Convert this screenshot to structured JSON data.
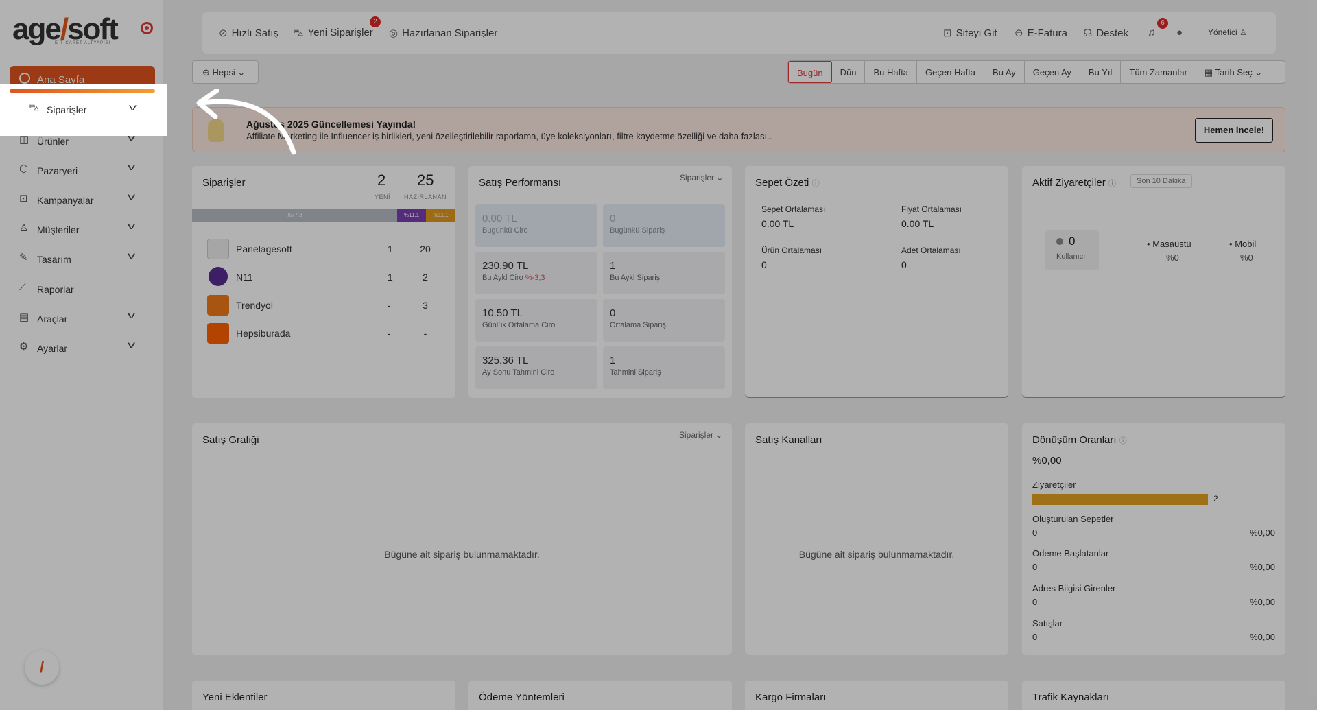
{
  "logo": {
    "brand_pre": "age",
    "brand_post": "soft",
    "tagline": "E-TİCARET ALTYAPISI"
  },
  "sidebar": {
    "home": "Ana Sayfa",
    "items": [
      {
        "label": "Siparişler",
        "icon": "cart-icon",
        "expandable": true
      },
      {
        "label": "Ürünler",
        "icon": "box-icon",
        "expandable": true
      },
      {
        "label": "Pazaryeri",
        "icon": "cube-icon",
        "expandable": true
      },
      {
        "label": "Kampanyalar",
        "icon": "gift-icon",
        "expandable": true
      },
      {
        "label": "Müşteriler",
        "icon": "user-icon",
        "expandable": true
      },
      {
        "label": "Tasarım",
        "icon": "pencil-icon",
        "expandable": true
      },
      {
        "label": "Raporlar",
        "icon": "chart-icon",
        "expandable": false
      },
      {
        "label": "Araçlar",
        "icon": "tools-icon",
        "expandable": true
      },
      {
        "label": "Ayarlar",
        "icon": "gear-icon",
        "expandable": true
      }
    ]
  },
  "topbar": {
    "quick_sale": "Hızlı Satış",
    "new_orders": "Yeni Siparişler",
    "new_orders_badge": "2",
    "preparing": "Hazırlanan Siparişler",
    "go_site": "Siteyi Git",
    "einvoice": "E-Fatura",
    "support": "Destek",
    "notif_badge": "6",
    "user": "Yönetici"
  },
  "filters": {
    "channel": "Hepsi",
    "dates": [
      "Bugün",
      "Dün",
      "Bu Hafta",
      "Geçen Hafta",
      "Bu Ay",
      "Geçen Ay",
      "Bu Yıl",
      "Tüm Zamanlar"
    ],
    "date_pick": "Tarih Seç",
    "active": "Bugün"
  },
  "banner": {
    "title": "Ağustos 2025 Güncellemesi Yayında!",
    "text": "Affiliate Marketing ile Influencer iş birlikleri, yeni özelleştirilebilir raporlama, üye koleksiyonları, filtre kaydetme özelliği ve daha fazlası..",
    "button": "Hemen İncele!"
  },
  "orders": {
    "title": "Siparişler",
    "new_count": "2",
    "new_label": "YENİ",
    "prep_count": "25",
    "prep_label": "HAZIRLANAN",
    "segments": [
      {
        "label": "%77,8",
        "value": 77.8,
        "color": "#b8bcc4"
      },
      {
        "label": "%11,1",
        "value": 11.1,
        "color": "#7a3fb0"
      },
      {
        "label": "%11,1",
        "value": 11.1,
        "color": "#e39a1e"
      }
    ],
    "marketplaces": [
      {
        "name": "Panelagesoft",
        "new": "1",
        "prep": "20"
      },
      {
        "name": "N11",
        "new": "1",
        "prep": "2"
      },
      {
        "name": "Trendyol",
        "new": "-",
        "prep": "3"
      },
      {
        "name": "Hepsiburada",
        "new": "-",
        "prep": "-"
      }
    ]
  },
  "sales_perf": {
    "title": "Satış Performansı",
    "dropdown": "Siparişler",
    "boxes": [
      {
        "value": "0.00 TL",
        "label": "Bugünkü Ciro"
      },
      {
        "value": "0",
        "label": "Bugünkü Sipariş"
      },
      {
        "value": "230.90 TL",
        "label": "Bu Aykl Ciro",
        "delta": "%-3,3"
      },
      {
        "value": "1",
        "label": "Bu Aykl Sipariş"
      },
      {
        "value": "10.50 TL",
        "label": "Günlük Ortalama Ciro"
      },
      {
        "value": "0",
        "label": "Ortalama Sipariş"
      },
      {
        "value": "325.36 TL",
        "label": "Ay Sonu Tahmini Ciro"
      },
      {
        "value": "1",
        "label": "Tahmini Sipariş"
      }
    ]
  },
  "cart_summary": {
    "title": "Sepet Özeti",
    "items": [
      {
        "label": "Sepet Ortalaması",
        "value": "0.00 TL"
      },
      {
        "label": "Fiyat Ortalaması",
        "value": "0.00 TL"
      },
      {
        "label": "Ürün Ortalaması",
        "value": "0"
      },
      {
        "label": "Adet Ortalaması",
        "value": "0"
      }
    ]
  },
  "visitors": {
    "title": "Aktif Ziyaretçiler",
    "period": "Son 10 Dakika",
    "count": "0",
    "count_label": "Kullanıcı",
    "desktop_label": "Masaüstü",
    "desktop_pct": "%0",
    "mobile_label": "Mobil",
    "mobile_pct": "%0"
  },
  "sales_chart": {
    "title": "Satış Grafiği",
    "dropdown": "Siparişler",
    "empty": "Bügüne ait sipariş bulunmamaktadır."
  },
  "sales_channels": {
    "title": "Satış Kanalları",
    "empty": "Bügüne ait sipariş bulunmamaktadır."
  },
  "conversion": {
    "title": "Dönüşüm Oranları",
    "rate": "%0,00",
    "rows": [
      {
        "label": "Ziyaretçiler",
        "value": "2",
        "pct": "",
        "fill": 1.0
      },
      {
        "label": "Oluşturulan Sepetler",
        "value": "0",
        "pct": "%0,00"
      },
      {
        "label": "Ödeme Başlatanlar",
        "value": "0",
        "pct": "%0,00"
      },
      {
        "label": "Adres Bilgisi Girenler",
        "value": "0",
        "pct": "%0,00"
      },
      {
        "label": "Satışlar",
        "value": "0",
        "pct": "%0,00"
      }
    ]
  },
  "bottom_cards": [
    "Yeni Eklentiler",
    "Ödeme Yöntemleri",
    "Kargo Firmaları",
    "Trafik Kaynakları"
  ],
  "colors": {
    "accent": "#e0541f",
    "active_filter": "#e03a3a",
    "bar": "#e3a224"
  }
}
